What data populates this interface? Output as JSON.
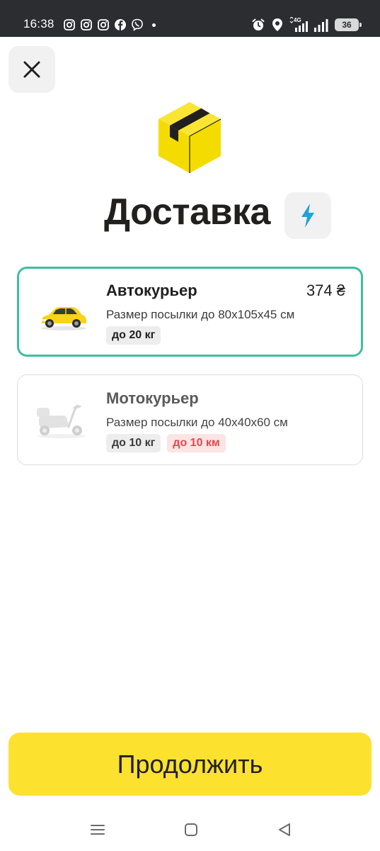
{
  "status_bar": {
    "time": "16:38",
    "left_icons": [
      "instagram-icon",
      "instagram-icon",
      "instagram-icon",
      "facebook-icon",
      "viber-icon",
      "dot"
    ],
    "right_icons": [
      "alarm-icon",
      "location-icon",
      "signal-4g-icon",
      "signal-icon"
    ],
    "network": "4G",
    "battery": "36"
  },
  "header": {
    "close_icon": "close-icon",
    "logo_icon": "box-logo-icon"
  },
  "title": {
    "text": "Доставка",
    "flash_icon": "lightning-icon",
    "colors": {
      "flash": "#1fa3d8",
      "logo_yellow": "#f5dc00"
    }
  },
  "options": [
    {
      "title": "Автокурьер",
      "price": "374 ₴",
      "description": "Размер посылки до 80x105x45 см",
      "badges": [
        "до 20 кг"
      ],
      "selected": true,
      "icon": "car-icon"
    },
    {
      "title": "Мотокурьер",
      "description": "Размер посылки до 40x40x60 см",
      "badges": [
        "до 10 кг",
        "до 10 км"
      ],
      "selected": false,
      "icon": "scooter-icon"
    }
  ],
  "continue_button": {
    "label": "Продолжить",
    "color": "#fde12f"
  },
  "nav_bar": {
    "items": [
      "menu-icon",
      "home-icon",
      "back-icon"
    ]
  },
  "colors": {
    "selected_border": "#3fbf9f",
    "warning_badge_text": "#e0494d"
  }
}
